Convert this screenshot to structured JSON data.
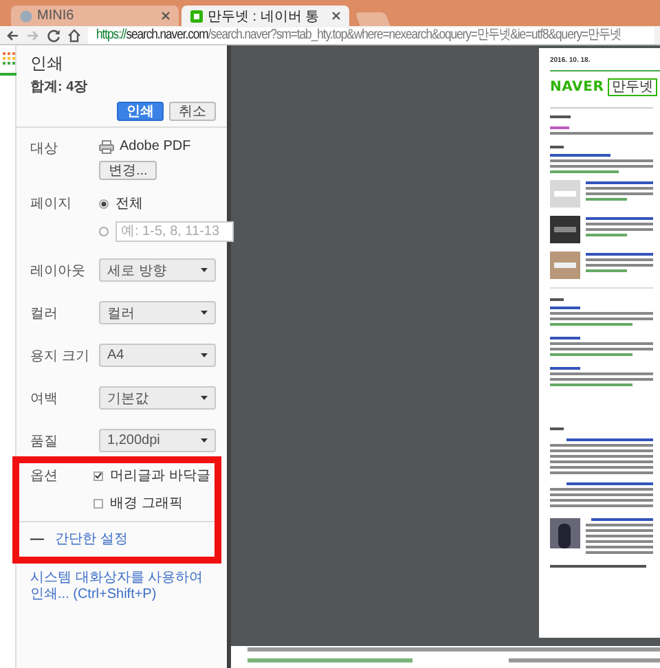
{
  "browser": {
    "tabs": [
      {
        "title": "MINI6",
        "selected": false
      },
      {
        "title": "만두넷 : 네이버 통",
        "selected": true
      }
    ],
    "url": "https://search.naver.com/search.naver?sm=tab_hty.top&where=nexearch&oquery=만두넷&ie=utf8&query=만두넷"
  },
  "print_dialog": {
    "title": "인쇄",
    "total": "합계: 4장",
    "buttons": [
      {
        "label": "인쇄",
        "kind": "primary"
      },
      {
        "label": "취소",
        "kind": "normal"
      }
    ],
    "destination": {
      "label": "대상",
      "printer": "Adobe PDF",
      "change_button": "변경..."
    },
    "pages": {
      "label": "페이지",
      "options": [
        {
          "label": "전체",
          "selected": true
        },
        {
          "placeholder": "예: 1-5, 8, 11-13",
          "selected": false
        }
      ]
    },
    "settings": [
      {
        "label": "레이아웃",
        "value": "세로 방향"
      },
      {
        "label": "컬러",
        "value": "컬러"
      },
      {
        "label": "용지 크기",
        "value": "A4"
      },
      {
        "label": "여백",
        "value": "기본값"
      },
      {
        "label": "품질",
        "value": "1,200dpi"
      }
    ],
    "options": {
      "label": "옵션",
      "checkboxes": [
        {
          "label": "머리글과 바닥글",
          "checked": true
        },
        {
          "label": "배경 그래픽",
          "checked": false
        }
      ]
    },
    "toggle": {
      "icon": "—",
      "label": "간단한 설정"
    },
    "system_dialog_link": "시스템 대화상자를 사용하여 인쇄... (Ctrl+Shift+P)"
  },
  "preview": {
    "date": "2016. 10. 18.",
    "logo": "NAVER",
    "query": "만두넷"
  }
}
